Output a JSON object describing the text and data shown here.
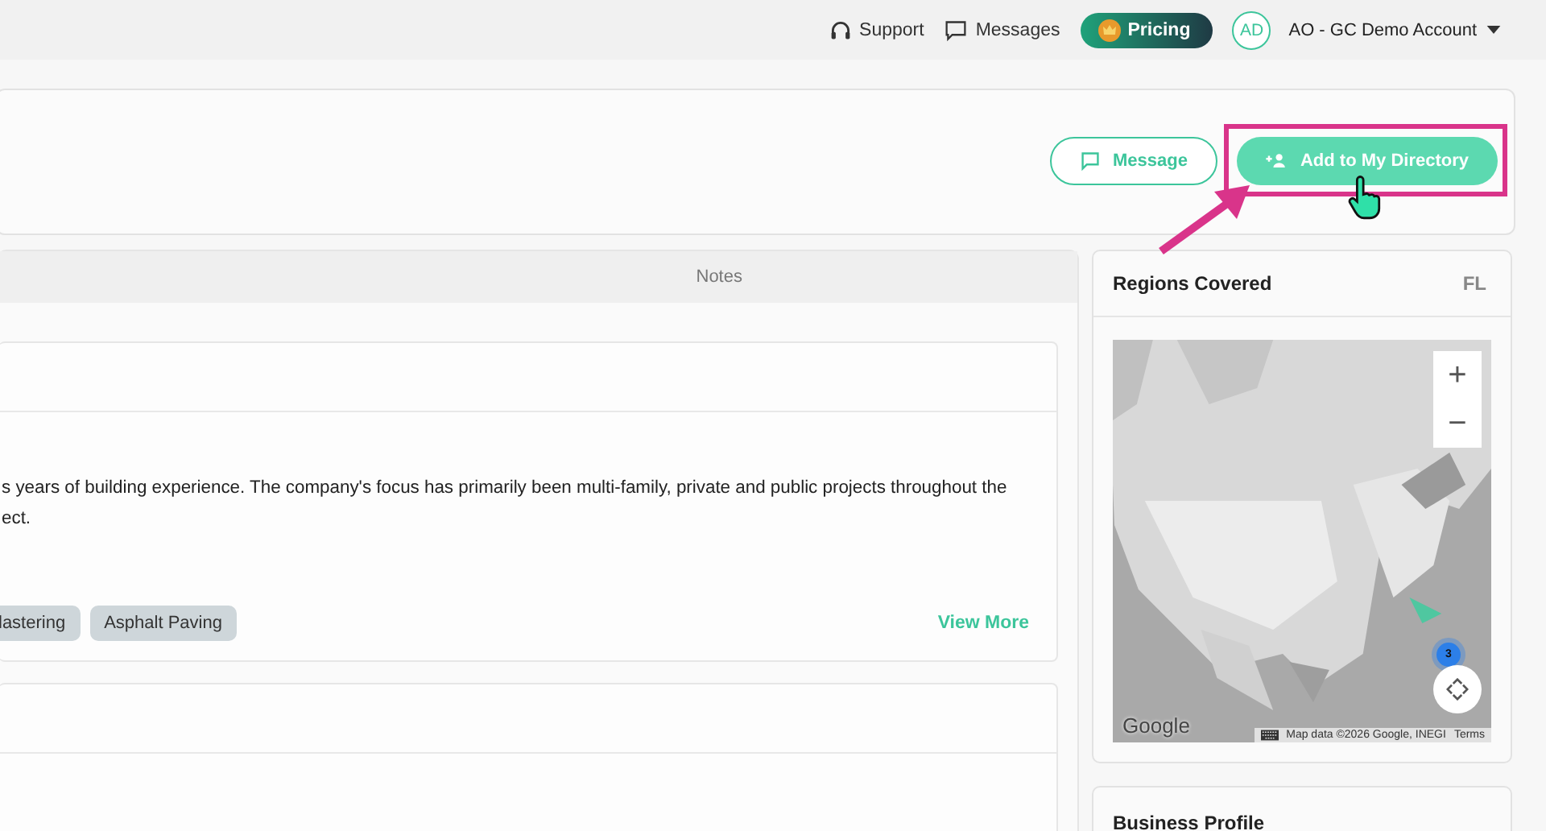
{
  "topbar": {
    "links": [
      {
        "kind": "support",
        "label": "Support"
      },
      {
        "kind": "messages",
        "label": "Messages"
      }
    ],
    "pricing": "Pricing",
    "account": {
      "initials": "AD",
      "name": "AO - GC Demo Account"
    }
  },
  "header_actions": [
    {
      "kind": "outline",
      "label": "Message",
      "highlighted": false
    },
    {
      "kind": "primary",
      "label": "Add to My Directory",
      "highlighted": true
    }
  ],
  "tabs": [
    {
      "label": "Notes",
      "selected": false
    }
  ],
  "about": {
    "description_lines": [
      "s years of building experience. The company's focus has primarily been multi-family, private and public projects throughout the",
      "ect."
    ],
    "tags": [
      "lastering",
      "Asphalt Paving"
    ],
    "view_more": "View More"
  },
  "regions": {
    "title": "Regions Covered",
    "state": "FL",
    "map": {
      "kind": "picture",
      "zoom_controls": [
        "+",
        "−"
      ],
      "cluster": "3",
      "logo": "Google",
      "attribution": "Map data ©2026 Google, INEGI",
      "terms": "Terms"
    }
  },
  "business_profile": {
    "title": "Business Profile"
  }
}
